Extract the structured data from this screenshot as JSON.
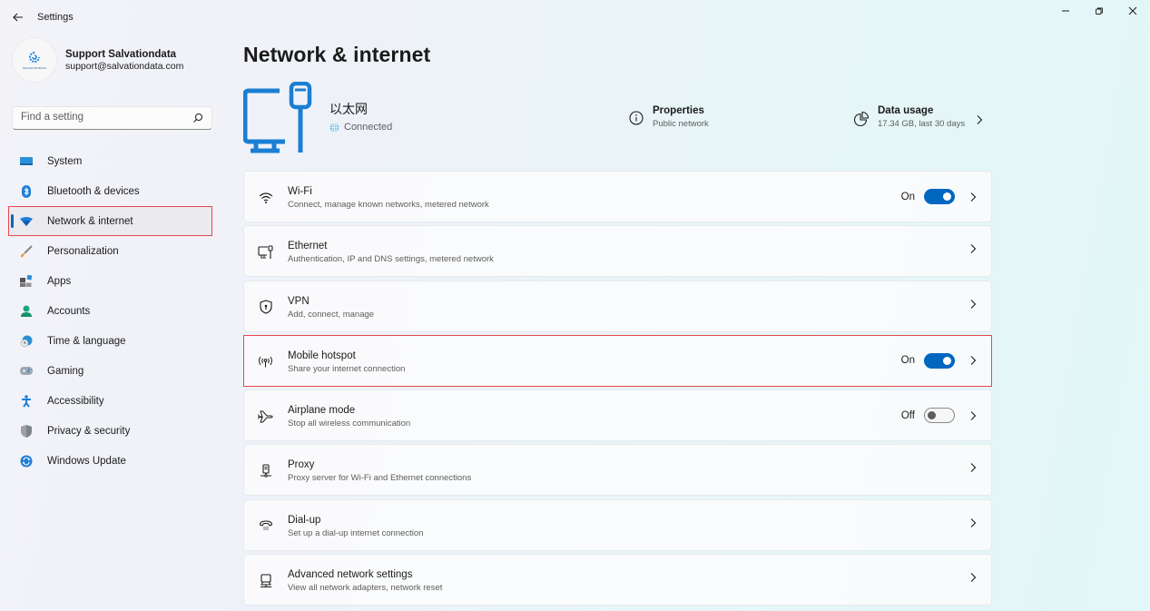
{
  "window": {
    "title": "Settings",
    "controls": [
      "minimize",
      "restore",
      "close"
    ]
  },
  "profile": {
    "name": "Support Salvationdata",
    "email": "support@salvationdata.com",
    "logo_text": "SALVATIONDATA"
  },
  "search": {
    "placeholder": "Find a setting",
    "value": ""
  },
  "sidebar": {
    "items": [
      {
        "label": "System",
        "icon": "system-icon",
        "active": false
      },
      {
        "label": "Bluetooth & devices",
        "icon": "bluetooth-icon",
        "active": false
      },
      {
        "label": "Network & internet",
        "icon": "wifi-icon",
        "active": true
      },
      {
        "label": "Personalization",
        "icon": "brush-icon",
        "active": false
      },
      {
        "label": "Apps",
        "icon": "apps-icon",
        "active": false
      },
      {
        "label": "Accounts",
        "icon": "person-icon",
        "active": false
      },
      {
        "label": "Time & language",
        "icon": "clock-globe-icon",
        "active": false
      },
      {
        "label": "Gaming",
        "icon": "gamepad-icon",
        "active": false
      },
      {
        "label": "Accessibility",
        "icon": "accessibility-icon",
        "active": false
      },
      {
        "label": "Privacy & security",
        "icon": "shield-icon",
        "active": false
      },
      {
        "label": "Windows Update",
        "icon": "update-icon",
        "active": false
      }
    ]
  },
  "main": {
    "title": "Network & internet",
    "hero": {
      "connection_name": "以太网",
      "status": "Connected",
      "properties_title": "Properties",
      "properties_sub": "Public network",
      "data_usage_title": "Data usage",
      "data_usage_sub": "17.34 GB, last 30 days"
    },
    "cards": [
      {
        "title": "Wi-Fi",
        "sub": "Connect, manage known networks, metered network",
        "icon": "wifi-icon",
        "toggle": "On"
      },
      {
        "title": "Ethernet",
        "sub": "Authentication, IP and DNS settings, metered network",
        "icon": "ethernet-icon",
        "toggle": null
      },
      {
        "title": "VPN",
        "sub": "Add, connect, manage",
        "icon": "vpn-shield-icon",
        "toggle": null
      },
      {
        "title": "Mobile hotspot",
        "sub": "Share your internet connection",
        "icon": "hotspot-icon",
        "toggle": "On"
      },
      {
        "title": "Airplane mode",
        "sub": "Stop all wireless communication",
        "icon": "airplane-icon",
        "toggle": "Off"
      },
      {
        "title": "Proxy",
        "sub": "Proxy server for Wi-Fi and Ethernet connections",
        "icon": "proxy-icon",
        "toggle": null
      },
      {
        "title": "Dial-up",
        "sub": "Set up a dial-up internet connection",
        "icon": "dialup-icon",
        "toggle": null
      },
      {
        "title": "Advanced network settings",
        "sub": "View all network adapters, network reset",
        "icon": "advanced-network-icon",
        "toggle": null
      }
    ]
  },
  "colors": {
    "accent": "#0067c0",
    "highlight_border": "#e5484d"
  }
}
